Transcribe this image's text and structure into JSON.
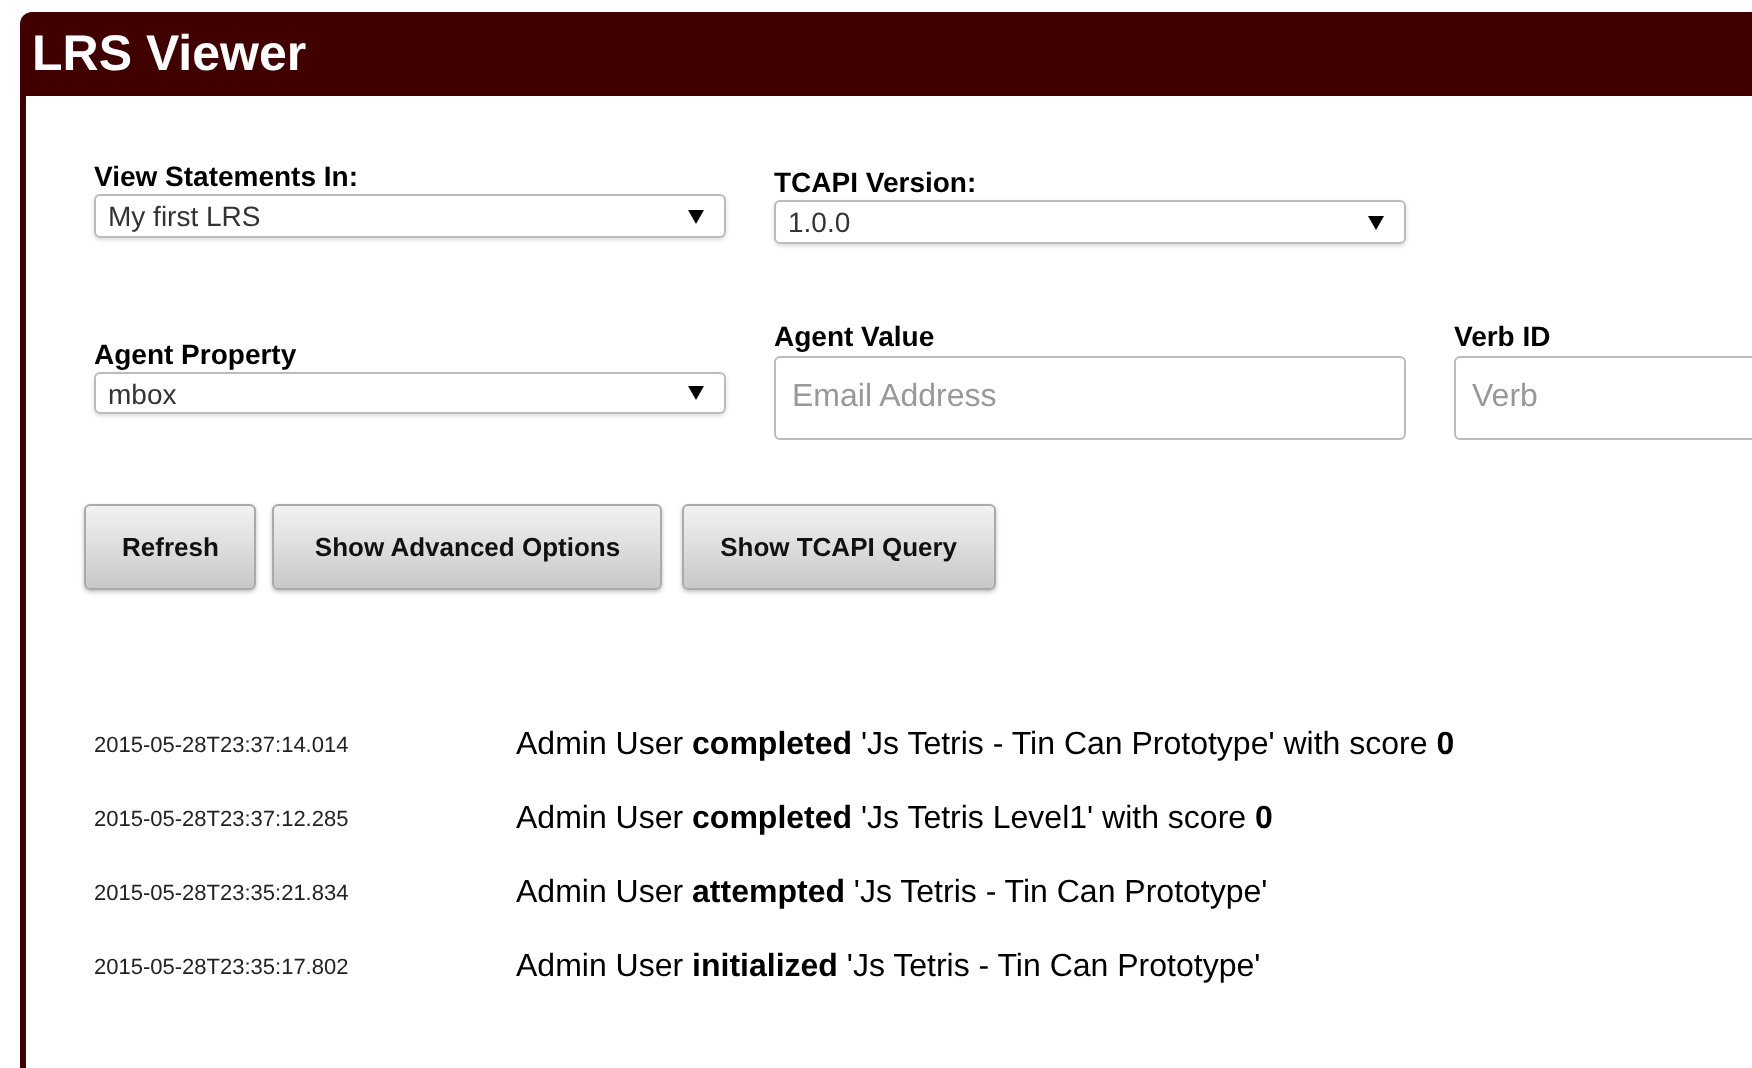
{
  "header": {
    "title": "LRS Viewer"
  },
  "filters": {
    "view_statements_in": {
      "label": "View Statements In:",
      "value": "My first LRS"
    },
    "tcapi_version": {
      "label": "TCAPI Version:",
      "value": "1.0.0"
    },
    "agent_property": {
      "label": "Agent Property",
      "value": "mbox"
    },
    "agent_value": {
      "label": "Agent Value",
      "placeholder": "Email Address"
    },
    "verb_id": {
      "label": "Verb ID",
      "placeholder": "Verb"
    }
  },
  "buttons": [
    "Refresh",
    "Show Advanced Options",
    "Show TCAPI Query"
  ],
  "statements": [
    {
      "timestamp": "2015-05-28T23:37:14.014",
      "text": "Admin User **completed** 'Js Tetris - Tin Can Prototype' with score **0**"
    },
    {
      "timestamp": "2015-05-28T23:37:12.285",
      "text": "Admin User **completed** 'Js Tetris Level1' with score **0**"
    },
    {
      "timestamp": "2015-05-28T23:35:21.834",
      "text": "Admin User **attempted** 'Js Tetris - Tin Can Prototype'"
    },
    {
      "timestamp": "2015-05-28T23:35:17.802",
      "text": "Admin User **initialized** 'Js Tetris - Tin Can Prototype'"
    }
  ]
}
